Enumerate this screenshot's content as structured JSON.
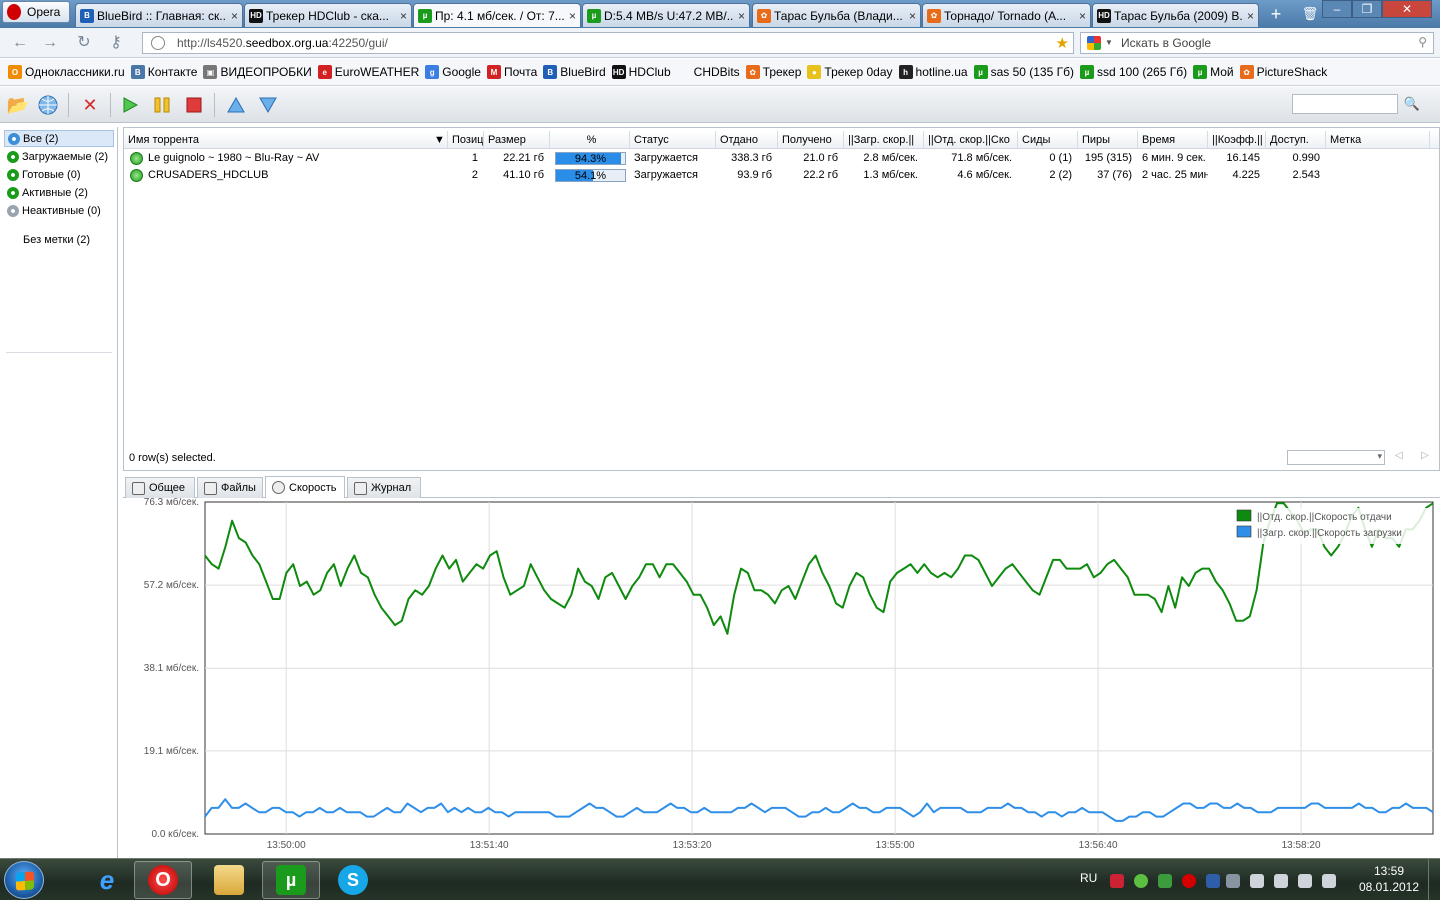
{
  "browser": {
    "menu_label": "Opera",
    "tabs": [
      {
        "label": "BlueBird :: Главная: ск...",
        "icon": "bluebird-icon",
        "color": "#1f5fb8",
        "glyph": "B"
      },
      {
        "label": "Трекер HDClub - ска...",
        "icon": "hdclub-icon",
        "color": "#111111",
        "glyph": "HD"
      },
      {
        "label": "Пр: 4.1 мб/сек. / От: 7...",
        "icon": "utorrent-icon",
        "color": "#1b9b1b",
        "glyph": "µ",
        "active": true
      },
      {
        "label": "D:5.4 MB/s U:47.2 MB/...",
        "icon": "utorrent-icon",
        "color": "#1b9b1b",
        "glyph": "µ"
      },
      {
        "label": "Тарас Бульба (Влади...",
        "icon": "kinopoisk-icon",
        "color": "#e86b1a",
        "glyph": "✿"
      },
      {
        "label": "Торнадо/ Tornado (A...",
        "icon": "kinopoisk-icon",
        "color": "#e86b1a",
        "glyph": "✿"
      },
      {
        "label": "Тарас Бульба (2009) В...",
        "icon": "hdclub-icon",
        "color": "#111111",
        "glyph": "HD"
      }
    ],
    "url_prefix": "http://ls4520.",
    "url_host": "seedbox.org.ua",
    "url_suffix": ":42250/gui/",
    "search_placeholder": "Искать в Google"
  },
  "bookmarks": [
    {
      "label": "Одноклассники.ru",
      "icon": "odnoklassniki-icon",
      "color": "#f08c00",
      "glyph": "O"
    },
    {
      "label": "Контакте",
      "icon": "vkontakte-icon",
      "color": "#4a76a8",
      "glyph": "B"
    },
    {
      "label": "ВИДЕОПРОБКИ",
      "icon": "videoprobki-icon",
      "color": "#777777",
      "glyph": "▣"
    },
    {
      "label": "EuroWEATHER",
      "icon": "euroweather-icon",
      "color": "#d32020",
      "glyph": "e"
    },
    {
      "label": "Google",
      "icon": "google-icon",
      "color": "#3b7de0",
      "glyph": "g"
    },
    {
      "label": "Почта",
      "icon": "mail-icon",
      "color": "#d22222",
      "glyph": "M"
    },
    {
      "label": "BlueBird",
      "icon": "bluebird-icon",
      "color": "#1f5fb8",
      "glyph": "B"
    },
    {
      "label": "HDClub",
      "icon": "hdclub-icon",
      "color": "#111111",
      "glyph": "HD"
    },
    {
      "label": "CHDBits",
      "icon": "chdbits-icon",
      "color": "#f5f7fa",
      "glyph": ""
    },
    {
      "label": "Трекер",
      "icon": "tracker-icon",
      "color": "#e86b1a",
      "glyph": "✿"
    },
    {
      "label": "Трекер 0day",
      "icon": "0day-icon",
      "color": "#e8c21a",
      "glyph": "●"
    },
    {
      "label": "hotline.ua",
      "icon": "hotline-icon",
      "color": "#222222",
      "glyph": "h"
    },
    {
      "label": "sas 50 (135 Гб)",
      "icon": "utorrent-icon",
      "color": "#1b9b1b",
      "glyph": "µ"
    },
    {
      "label": "ssd 100 (265 Гб)",
      "icon": "utorrent-icon",
      "color": "#1b9b1b",
      "glyph": "µ"
    },
    {
      "label": "Мой",
      "icon": "utorrent-icon",
      "color": "#1b9b1b",
      "glyph": "µ"
    },
    {
      "label": "PictureShack",
      "icon": "pictureshack-icon",
      "color": "#e86b1a",
      "glyph": "✿"
    }
  ],
  "sidebar": {
    "categories": [
      {
        "label": "Все (2)",
        "icon": "all-torrents-icon",
        "color": "#3c8fd8",
        "selected": true
      },
      {
        "label": "Загружаемые (2)",
        "icon": "downloading-icon",
        "color": "#1b9b1b"
      },
      {
        "label": "Готовые (0)",
        "icon": "completed-icon",
        "color": "#1b9b1b"
      },
      {
        "label": "Активные (2)",
        "icon": "active-icon",
        "color": "#1b9b1b"
      },
      {
        "label": "Неактивные (0)",
        "icon": "inactive-icon",
        "color": "#9aa4ae"
      }
    ],
    "label_item": "Без метки (2)"
  },
  "list": {
    "columns": [
      "Имя торрента",
      "Позиц",
      "Размер",
      "%",
      "Статус",
      "Отдано",
      "Получено",
      "||Загр. скор.||",
      "||Отд. скор.||Ско",
      "Сиды",
      "Пиры",
      "Время",
      "||Коэфф.||",
      "Доступ.",
      "Метка"
    ],
    "rows": [
      {
        "name": "Le guignolo ~ 1980 ~ Blu-Ray ~ AV",
        "pos": "1",
        "size": "22.21 гб",
        "percent_text": "94.3%",
        "percent": 94.3,
        "status": "Загружается",
        "uploaded": "338.3 гб",
        "downloaded": "21.0 гб",
        "down_speed": "2.8 мб/сек.",
        "up_speed": "71.8 мб/сек.",
        "seeds": "0 (1)",
        "peers": "195 (315)",
        "eta": "6 мин. 9 сек.",
        "ratio": "16.145",
        "avail": "0.990",
        "label": ""
      },
      {
        "name": "CRUSADERS_HDCLUB",
        "pos": "2",
        "size": "41.10 гб",
        "percent_text": "54.1%",
        "percent": 54.1,
        "status": "Загружается",
        "uploaded": "93.9 гб",
        "downloaded": "22.2 гб",
        "down_speed": "1.3 мб/сек.",
        "up_speed": "4.6 мб/сек.",
        "seeds": "2 (2)",
        "peers": "37 (76)",
        "eta": "2 час. 25 мин",
        "ratio": "4.225",
        "avail": "2.543",
        "label": ""
      }
    ],
    "status_text": "0 row(s) selected."
  },
  "detail_tabs": [
    {
      "label": "Общее",
      "icon": "general-icon"
    },
    {
      "label": "Файлы",
      "icon": "files-icon"
    },
    {
      "label": "Скорость",
      "icon": "speed-icon",
      "active": true
    },
    {
      "label": "Журнал",
      "icon": "log-icon"
    }
  ],
  "chart_data": {
    "type": "line",
    "y_tick_labels": [
      "76.3 мб/сек.",
      "57.2 мб/сек.",
      "38.1 мб/сек.",
      "19.1 мб/сек.",
      "0.0 кб/сек."
    ],
    "y_ticks": [
      76.3,
      57.2,
      38.1,
      19.1,
      0.0
    ],
    "ylim": [
      0,
      76.3
    ],
    "x_tick_labels": [
      "13:50:00",
      "13:51:40",
      "13:53:20",
      "13:55:00",
      "13:56:40",
      "13:58:20"
    ],
    "x_range_seconds": [
      -40,
      565
    ],
    "grid": true,
    "legend_position": "top-right",
    "series": [
      {
        "name": "||Отд. скор.||Скорость отдачи",
        "color": "#0e8a0e",
        "values": [
          64,
          62,
          61,
          66,
          72,
          68,
          67,
          64,
          62,
          58,
          54,
          54,
          60,
          62,
          57,
          58,
          55,
          56,
          60,
          62,
          57,
          61,
          64,
          60,
          59,
          55,
          52,
          50,
          48,
          49,
          54,
          56,
          55,
          57,
          61,
          64,
          61,
          63,
          58,
          60,
          62,
          61,
          64,
          65,
          59,
          55,
          56,
          57,
          62,
          59,
          56,
          54,
          53,
          52,
          55,
          61,
          58,
          57,
          54,
          59,
          60,
          57,
          54,
          57,
          59,
          62,
          62,
          59,
          62,
          62,
          60,
          58,
          55,
          55,
          52,
          48,
          50,
          46,
          55,
          61,
          60,
          56,
          56,
          55,
          53,
          56,
          57,
          54,
          58,
          62,
          64,
          60,
          57,
          53,
          52,
          57,
          60,
          59,
          55,
          52,
          51,
          58,
          60,
          61,
          62,
          60,
          62,
          60,
          59,
          60,
          59,
          61,
          64,
          64,
          63,
          60,
          57,
          59,
          61,
          62,
          60,
          58,
          56,
          55,
          59,
          63,
          63,
          61,
          61,
          61,
          62,
          59,
          60,
          62,
          63,
          61,
          59,
          55,
          55,
          55,
          54,
          51,
          57,
          52,
          59,
          57,
          60,
          61,
          61,
          58,
          56,
          53,
          49,
          49,
          50,
          56,
          67,
          72,
          76,
          76,
          74,
          72,
          69,
          70,
          70,
          66,
          64,
          66,
          69,
          73,
          75,
          70,
          66,
          70,
          68,
          68,
          66,
          70,
          70,
          72,
          75,
          76
        ]
      },
      {
        "name": "||Загр. скор.||Скорость загрузки",
        "color": "#2f8fe8",
        "values": [
          4,
          6,
          6,
          8,
          6,
          6,
          7,
          6,
          5,
          5,
          6,
          6,
          5,
          5,
          4,
          5,
          5,
          6,
          5,
          5,
          6,
          5,
          5,
          5,
          4,
          4,
          5,
          6,
          5,
          5,
          7,
          6,
          5,
          6,
          6,
          7,
          5,
          6,
          5,
          6,
          5,
          5,
          6,
          5,
          5,
          4,
          5,
          5,
          5,
          5,
          5,
          5,
          4,
          4,
          4,
          5,
          6,
          7,
          6,
          6,
          5,
          4,
          4,
          5,
          6,
          5,
          5,
          5,
          6,
          7,
          6,
          6,
          5,
          5,
          6,
          5,
          5,
          5,
          5,
          6,
          6,
          7,
          6,
          5,
          6,
          6,
          6,
          5,
          4,
          4,
          5,
          5,
          6,
          5,
          5,
          6,
          7,
          6,
          6,
          5,
          5,
          6,
          6,
          6,
          5,
          4,
          5,
          7,
          5,
          6,
          6,
          6,
          6,
          5,
          5,
          5,
          6,
          6,
          6,
          7,
          6,
          6,
          5,
          5,
          4,
          5,
          5,
          4,
          5,
          5,
          6,
          5,
          5,
          5,
          4,
          3,
          3,
          4,
          4,
          5,
          5,
          4,
          4,
          5,
          6,
          7,
          7,
          6,
          6,
          7,
          7,
          6,
          6,
          7,
          6,
          6,
          5,
          5,
          5,
          6,
          6,
          6,
          6,
          6,
          7,
          7,
          6,
          6,
          6,
          6,
          6,
          7,
          6,
          6,
          5,
          5,
          6,
          6,
          7,
          6,
          6,
          6,
          5
        ]
      }
    ]
  },
  "taskbar": {
    "lang": "RU",
    "time": "13:59",
    "date": "08.01.2012"
  }
}
